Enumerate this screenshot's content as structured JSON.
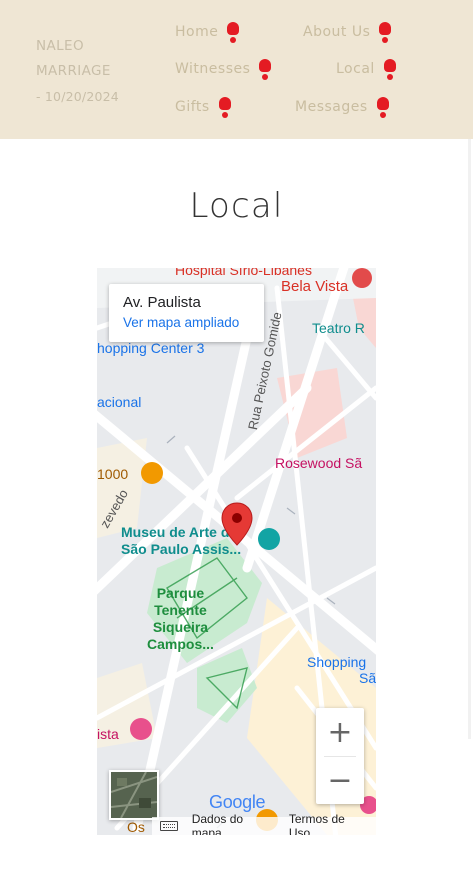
{
  "header": {
    "brand": {
      "line1": "NALEO",
      "line2": "MARRIAGE",
      "line3": "- 10/20/2024"
    },
    "nav": [
      {
        "label": "Home"
      },
      {
        "label": "About Us"
      },
      {
        "label": "Witnesses"
      },
      {
        "label": "Local"
      },
      {
        "label": "Gifts"
      },
      {
        "label": "Messages"
      }
    ]
  },
  "page": {
    "title": "Local"
  },
  "map": {
    "card": {
      "title": "Av. Paulista",
      "link": "Ver mapa ampliado"
    },
    "labels": {
      "hospital": "Hospital Sírio-Libanês",
      "bela_vista": "Bela Vista",
      "teatro": "Teatro R",
      "shopping_center": "hopping Center 3",
      "street_gomide": "Rua Peixoto Gomide",
      "nacional": "acional",
      "rosewood": "Rosewood Sã",
      "num1000": "1000",
      "azevedo": "zevedo",
      "museu1": "Museu de Arte de",
      "museu2": "São Paulo Assis...",
      "parque": "Parque\nTenente\nSiqueira\nCampos...",
      "shopping2a": "Shopping",
      "shopping2b": "Sã",
      "vista": "ista",
      "os": "Os",
      "google": "Google"
    },
    "zoom": {
      "in": "+",
      "out": "−"
    },
    "attribution": {
      "data": "Dados do mapa",
      "terms": "Termos de Uso"
    }
  },
  "colors": {
    "header_bg": "#efe6d4",
    "nav_text": "#c9bda0",
    "accent": "#e41b23"
  }
}
